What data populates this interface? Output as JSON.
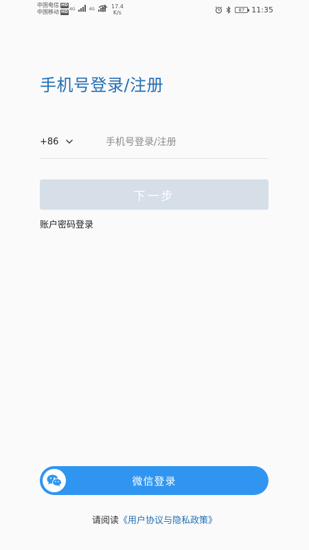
{
  "status_bar": {
    "carrier_1": "中国电信",
    "carrier_2": "中国移动",
    "hd_badge": "HD",
    "network_1": "4G",
    "network_2": "4G",
    "speed_value": "17.4",
    "speed_unit": "K/s",
    "battery": "87",
    "time": "11:35",
    "icons": [
      "alarm-icon",
      "bluetooth-icon",
      "wifi-icon",
      "signal-icon",
      "battery-icon"
    ]
  },
  "page": {
    "title": "手机号登录/注册"
  },
  "phone": {
    "country_code": "+86",
    "placeholder": "手机号登录/注册",
    "value": ""
  },
  "actions": {
    "next_label": "下一步",
    "password_login_label": "账户密码登录",
    "wechat_login_label": "微信登录"
  },
  "agreement": {
    "prefix": "请阅读",
    "link_text": "《用户协议与隐私政策》"
  },
  "colors": {
    "accent": "#1f6fb5",
    "wechat_button": "#2f95f0",
    "disabled_button": "#d6dee8"
  }
}
